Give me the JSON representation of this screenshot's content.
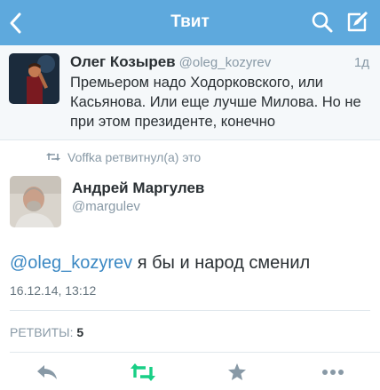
{
  "header": {
    "title": "Твит",
    "bg_color": "#5ea9dd"
  },
  "parent_tweet": {
    "name": "Олег Козырев",
    "handle": "@oleg_kozyrev",
    "time": "1д",
    "text": "Премьером надо Ходорковского, или Касьянова. Или еще лучше Милова. Но не при этом президенте, конечно"
  },
  "retweet_context": {
    "icon": "retweet-icon",
    "text": "Voffka ретвитнул(а) это"
  },
  "main_tweet": {
    "name": "Андрей Маргулев",
    "handle": "@margulev",
    "mention": "@oleg_kozyrev",
    "text": " я бы и народ сменил",
    "date": "16.12.14, 13:12",
    "retweets_label": "РЕТВИТЫ:",
    "retweets_count": "5"
  },
  "actions": [
    "reply-icon",
    "retweet-icon",
    "favorite-icon",
    "more-icon"
  ],
  "colors": {
    "accent": "#5ea9dd",
    "link": "#3b88c3",
    "retweet_green": "#19cf86",
    "muted": "#8899a6"
  }
}
